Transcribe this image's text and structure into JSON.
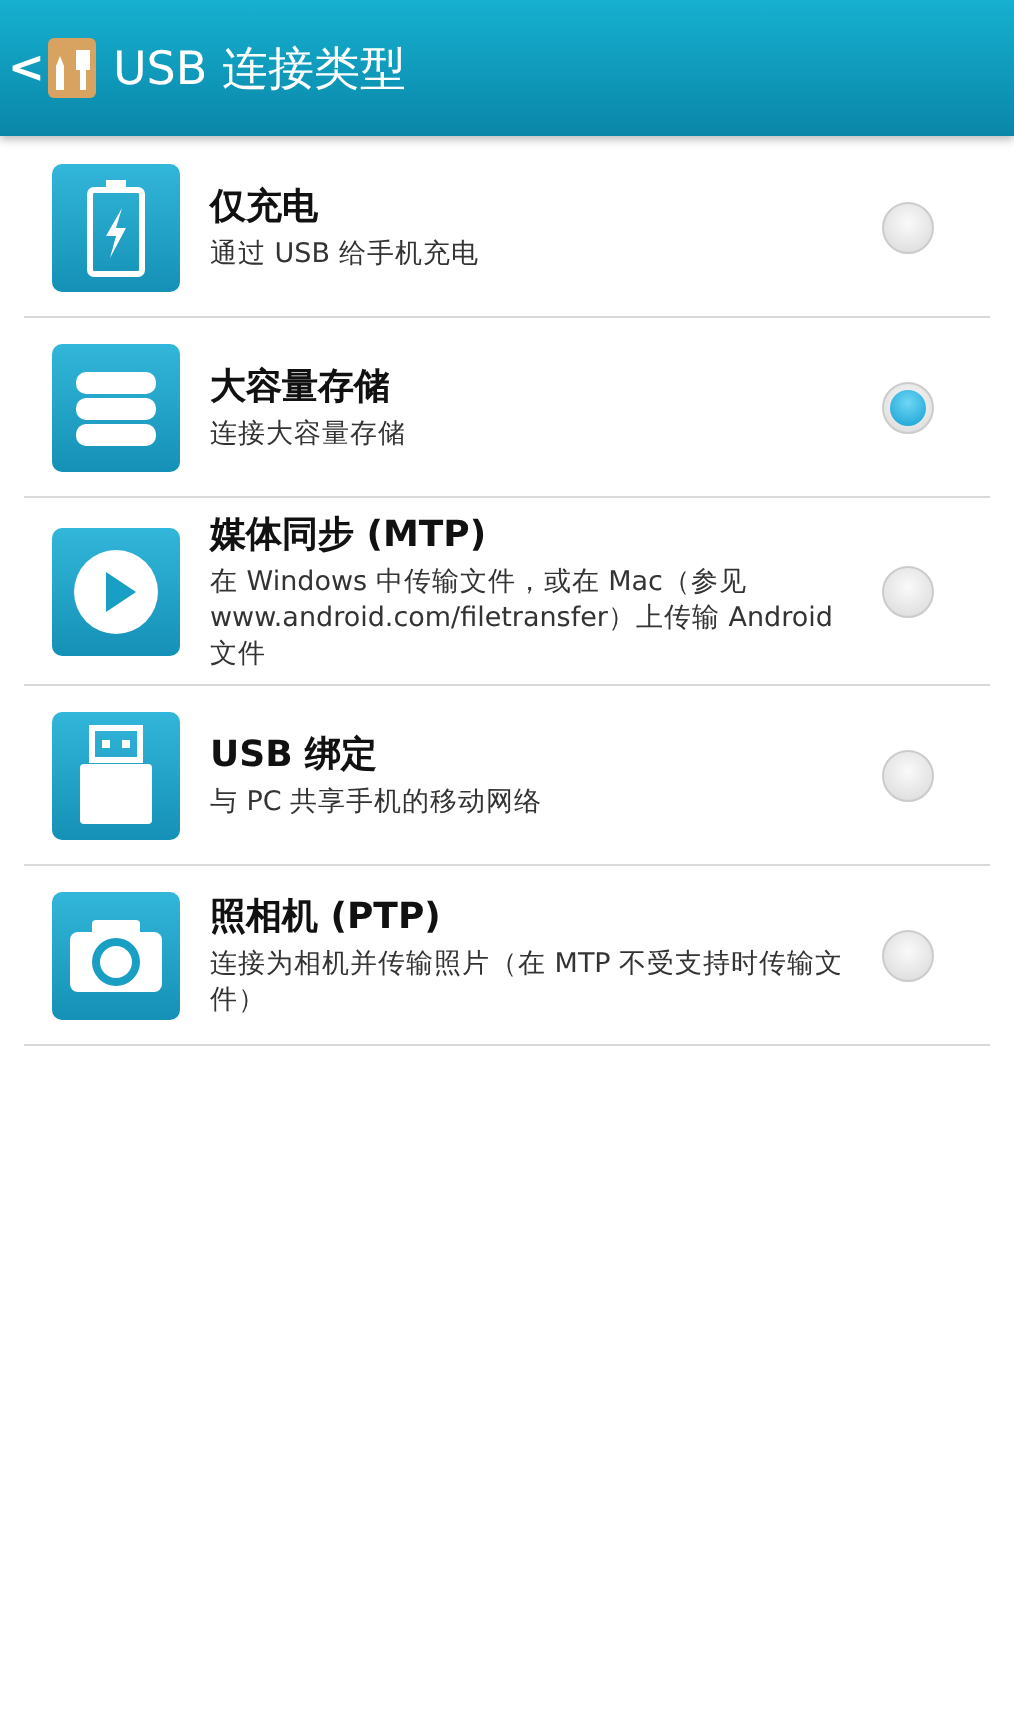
{
  "header": {
    "back": "<",
    "title": "USB 连接类型"
  },
  "options": [
    {
      "kind": "battery",
      "title": "仅充电",
      "description": "通过 USB 给手机充电",
      "selected": false
    },
    {
      "kind": "storage",
      "title": "大容量存储",
      "description": "连接大容量存储",
      "selected": true
    },
    {
      "kind": "media",
      "title": "媒体同步 (MTP)",
      "description": "在 Windows 中传输文件，或在 Mac（参见 www.android.com/filetransfer）上传输 Android 文件",
      "selected": false
    },
    {
      "kind": "usb",
      "title": "USB 绑定",
      "description": "与 PC 共享手机的移动网络",
      "selected": false
    },
    {
      "kind": "camera",
      "title": "照相机 (PTP)",
      "description": "连接为相机并传输照片（在 MTP 不受支持时传输文件）",
      "selected": false
    }
  ]
}
